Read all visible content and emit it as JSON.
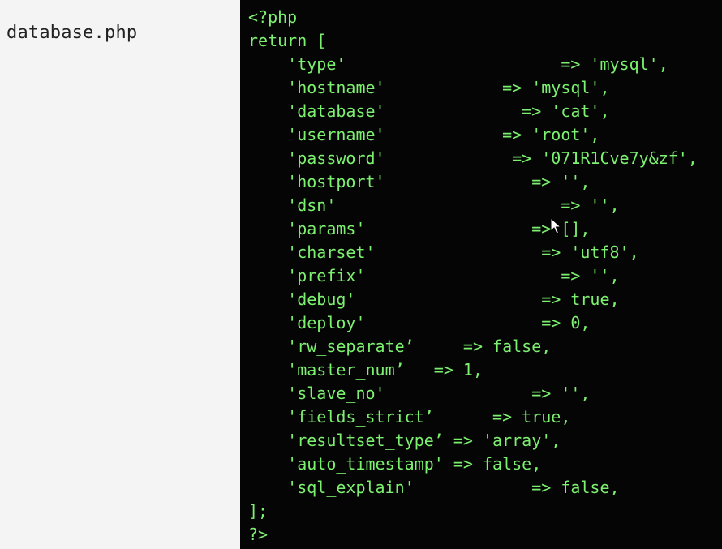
{
  "filename": "database.php",
  "code": {
    "open_tag": "<?php",
    "return_open": "return [",
    "entries": [
      {
        "text": "    'type'                      => 'mysql',"
      },
      {
        "text": "    'hostname'            => 'mysql',"
      },
      {
        "text": "    'database'              => 'cat',"
      },
      {
        "text": "    'username'            => 'root',"
      },
      {
        "text": "    'password'             => '071R1Cve7y&zf',"
      },
      {
        "text": "    'hostport'               => '',"
      },
      {
        "text": "    'dsn'                       => '',"
      },
      {
        "text": "    'params'                 => [],"
      },
      {
        "text": "    'charset'                 => 'utf8',"
      },
      {
        "text": "    'prefix'                    => '',"
      },
      {
        "text": "    'debug'                   => true,"
      },
      {
        "text": "    'deploy'                  => 0,"
      },
      {
        "text": "    'rw_separate’     => false,"
      },
      {
        "text": "    'master_num’   => 1,"
      },
      {
        "text": "    'slave_no'               => '',"
      },
      {
        "text": "    'fields_strict’      => true,"
      },
      {
        "text": "    'resultset_type’ => 'array',"
      },
      {
        "text": "    'auto_timestamp' => false,"
      },
      {
        "text": "    'sql_explain'            => false,"
      }
    ],
    "return_close": "];",
    "close_tag": "?>"
  }
}
